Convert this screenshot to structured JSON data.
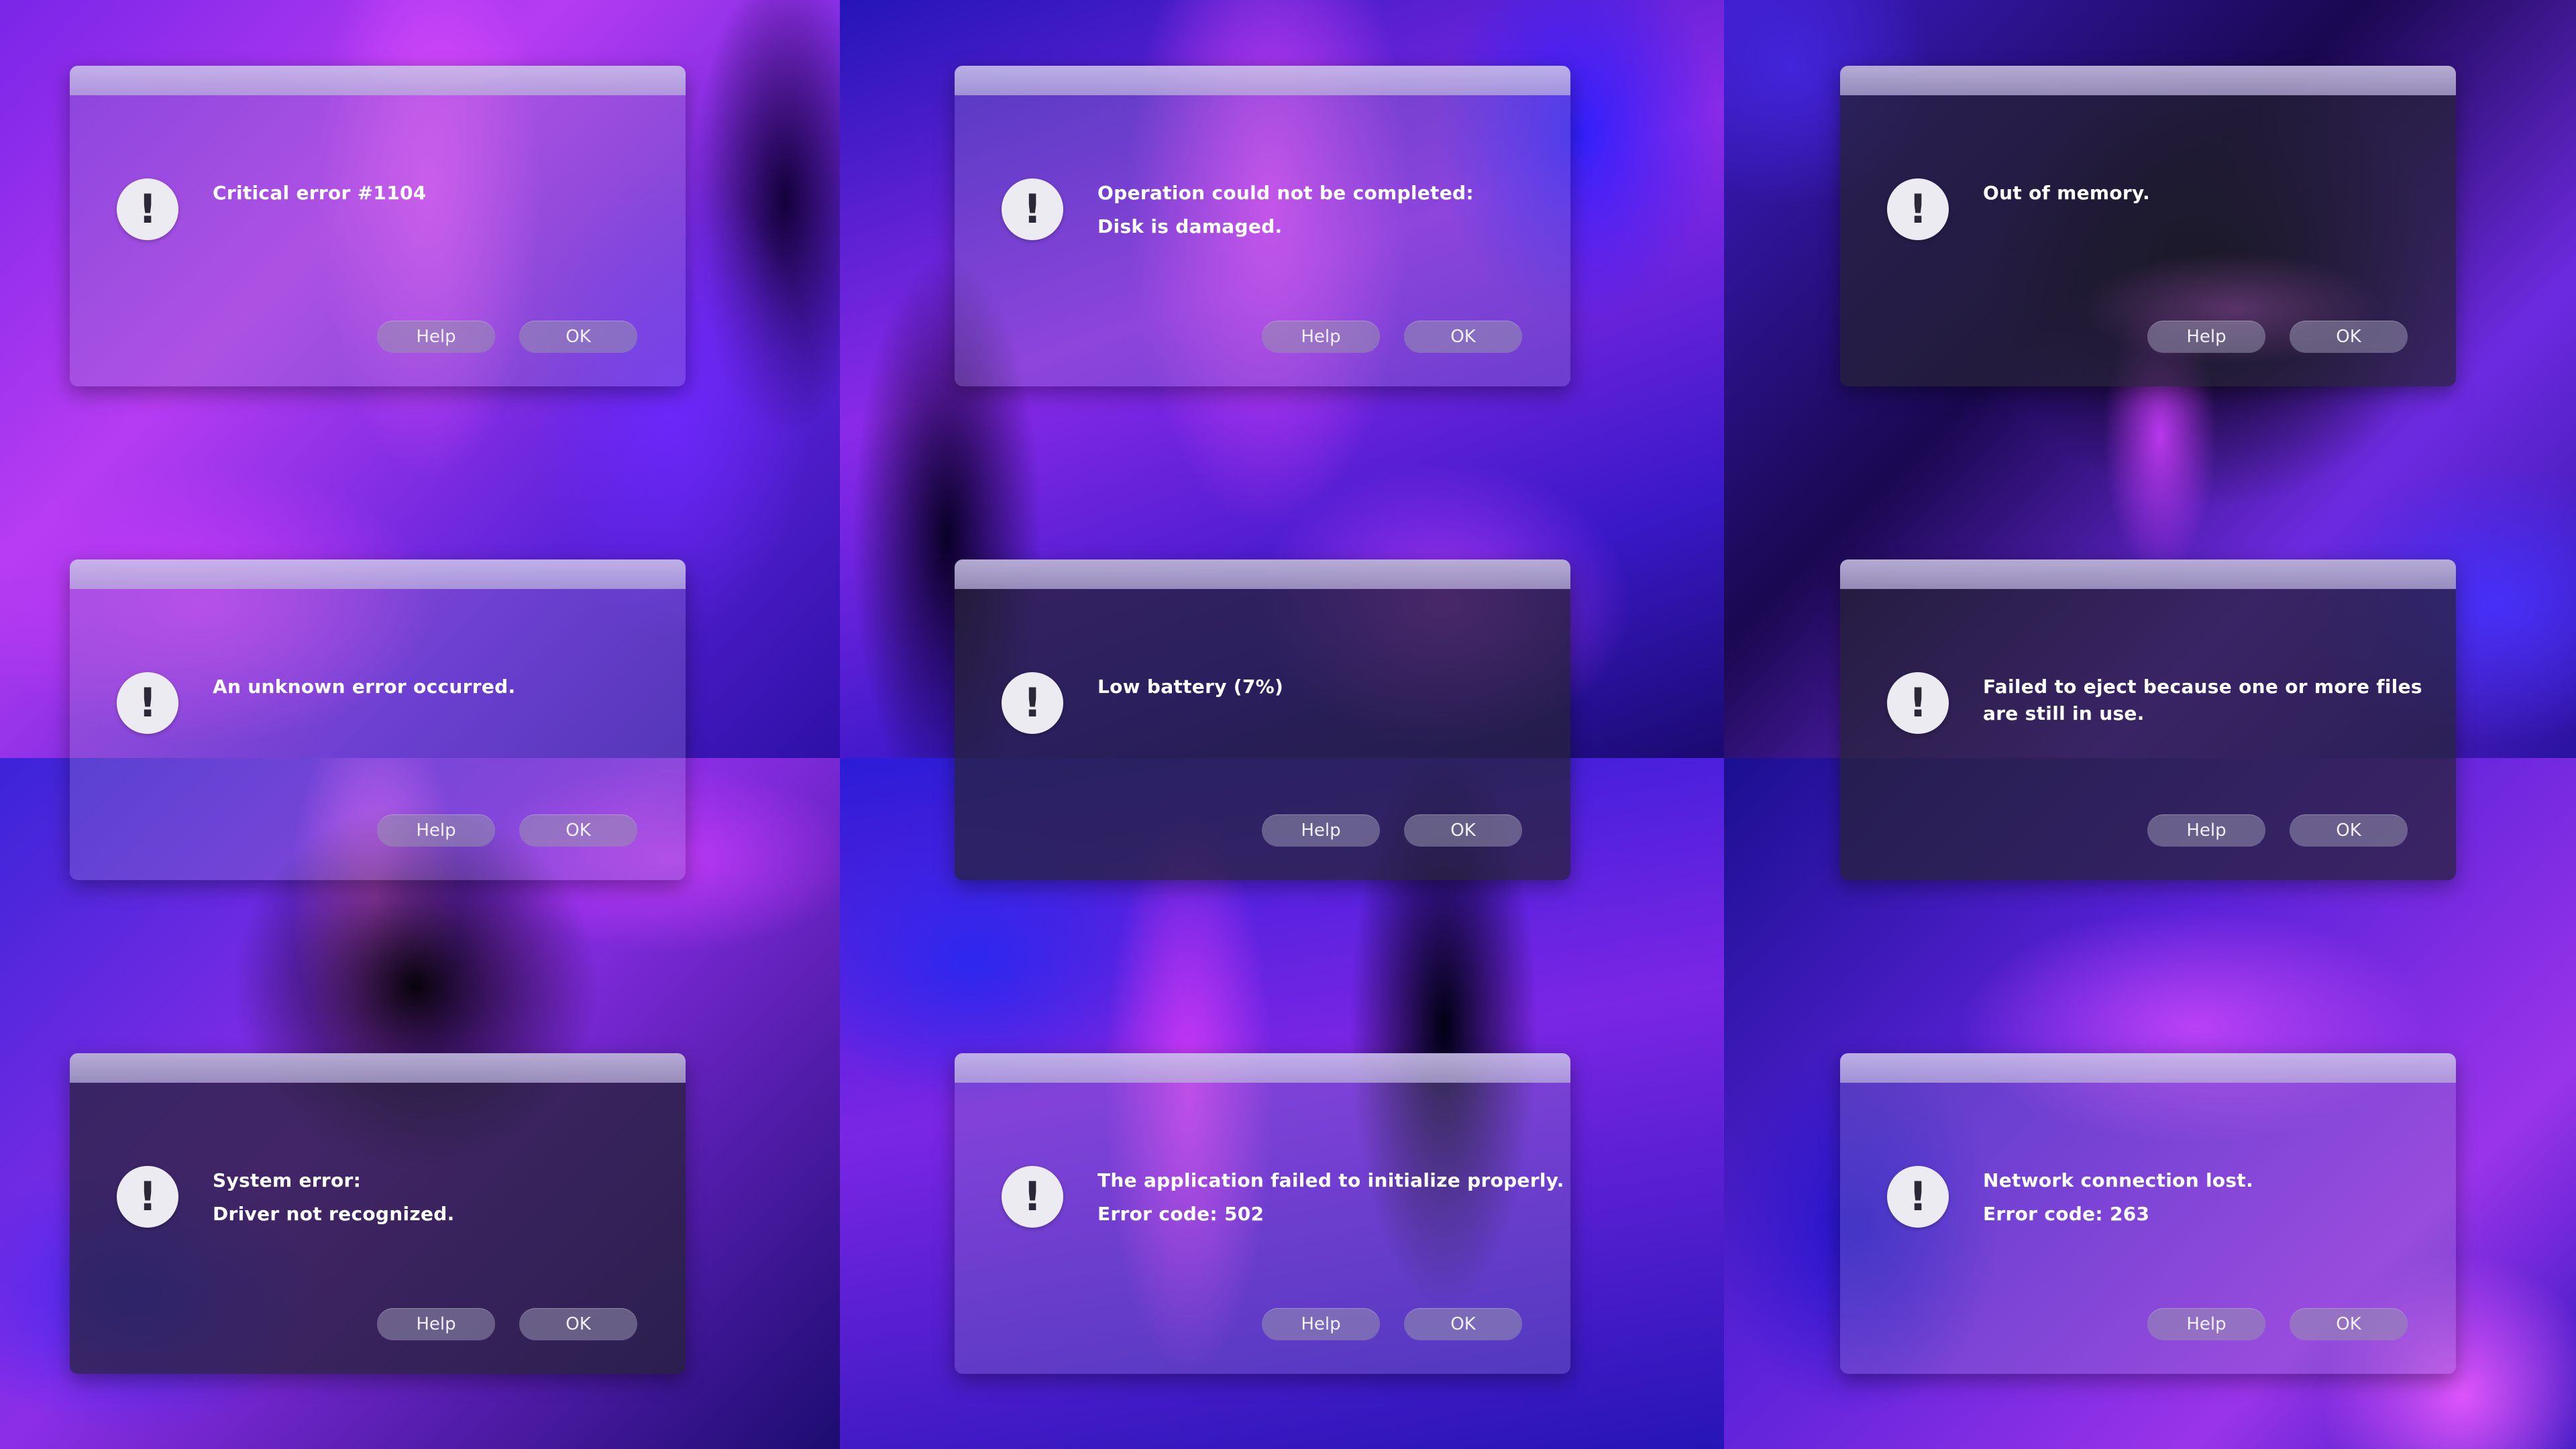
{
  "buttons": {
    "help": "Help",
    "ok": "OK"
  },
  "dialogs": [
    {
      "lines": [
        "Critical error #1104"
      ]
    },
    {
      "lines": [
        "Operation could not be completed:",
        "Disk is damaged."
      ]
    },
    {
      "lines": [
        "Out of memory."
      ]
    },
    {
      "lines": [
        "An unknown error occurred."
      ]
    },
    {
      "lines": [
        "Low battery (7%)"
      ]
    },
    {
      "lines": [
        "Failed to eject because one or more files",
        "are still in use."
      ]
    },
    {
      "lines": [
        "System error:",
        "Driver not recognized."
      ]
    },
    {
      "lines": [
        "The application failed to initialize properly.",
        "Error code: 502"
      ]
    },
    {
      "lines": [
        "Network connection lost.",
        "Error code: 263"
      ]
    }
  ],
  "icon": {
    "name": "exclamation-alert-icon",
    "glyph": "!"
  },
  "colors": {
    "accent_pink": "#d84cf8",
    "accent_blue": "#3a2ae0",
    "titlebar": "#c9c1e8",
    "button": "#8f8aa8"
  }
}
